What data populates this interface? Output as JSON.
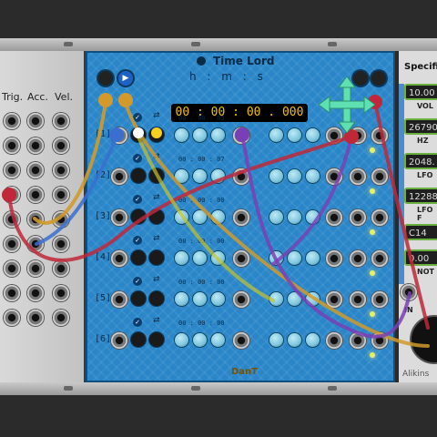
{
  "left_module": {
    "headers": [
      "Trig.",
      "Acc.",
      "Vel."
    ]
  },
  "time_lord": {
    "title": "Time Lord",
    "hms_label": "h : m : s",
    "clock_display": "00 : 00 : 00 . 000",
    "brand": "DanT",
    "rows": [
      {
        "label": "[1]",
        "time": "00 : 00 : 05"
      },
      {
        "label": "[2]",
        "time": "00 : 00 : 07"
      },
      {
        "label": "[3]",
        "time": "00 : 00 : 00"
      },
      {
        "label": "[4]",
        "time": "00 : 00 : 00"
      },
      {
        "label": "[5]",
        "time": "00 : 00 : 00"
      },
      {
        "label": "[6]",
        "time": "00 : 00 : 00"
      }
    ]
  },
  "spec_module": {
    "title": "Specific",
    "fields": [
      {
        "value": "10.00",
        "label": "VOL"
      },
      {
        "value": "26790",
        "label": "HZ"
      },
      {
        "value": "2048.",
        "label": "LFO"
      },
      {
        "value": "12288",
        "label": "LFO F"
      },
      {
        "value": "C14",
        "label": ""
      },
      {
        "value": "0.00",
        "label": "NOT"
      }
    ],
    "in_label": "IN",
    "brand": "Alikins"
  },
  "colors": {
    "panel_blue": "#2a86c8",
    "clock_text": "#f2c200",
    "field_border": "#6ab03f",
    "move_cursor": "#5fe0b3"
  }
}
